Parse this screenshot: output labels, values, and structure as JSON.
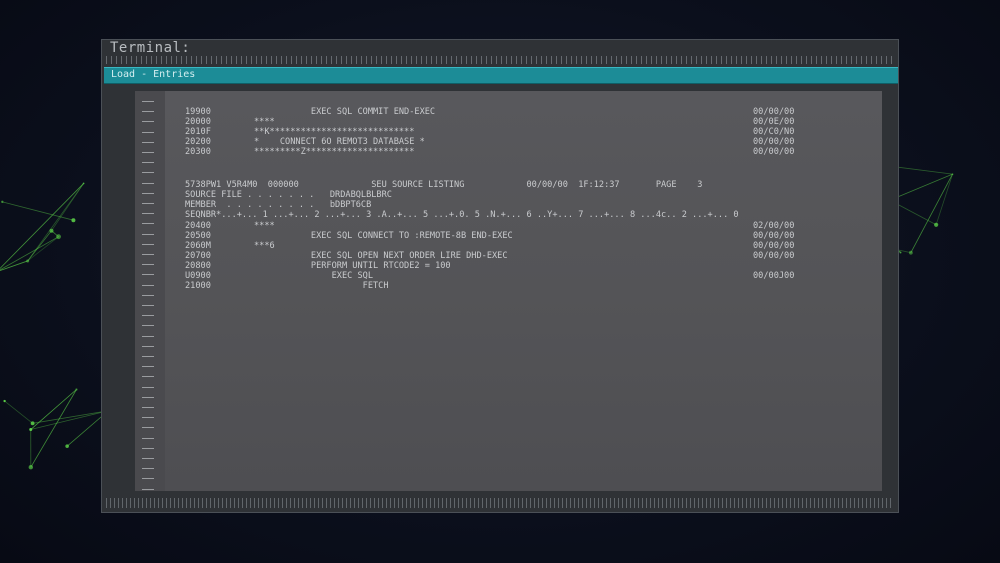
{
  "window": {
    "title": "Terminal:",
    "menu": "Load - Entries"
  },
  "listing": {
    "header_line": "5738PW1 V5R4M0  000000              SEU SOURCE LISTING            00/00/00  1F:12:37       PAGE    3",
    "source_file_line": "SOURCE FILE . . . . . . .   DRDABQLBLBRC",
    "member_line": "MEMBER  . . . . . . . . .   bDBPT6CB",
    "seq_ruler_line": "SEQNBR*...+... 1 ...+... 2 ...+... 3 .A..+... 5 ...+.0. 5 .N.+... 6 ..Y+... 7 ...+... 8 ...4c.. 2 ...+... 0",
    "block1": [
      {
        "seq": "19900",
        "code": "           EXEC SQL COMMIT END-EXEC",
        "stat": "00/00/00"
      },
      {
        "seq": "20000",
        "code": "****",
        "stat": "00/0E/00"
      },
      {
        "seq": "2010F",
        "code": "**K****************************",
        "stat": "00/C0/N0"
      },
      {
        "seq": "20200",
        "code": "*    CONNECT 6O REMOT3 DATABASE *",
        "stat": "00/00/00"
      },
      {
        "seq": "20300",
        "code": "*********Z*********************",
        "stat": "00/00/00"
      }
    ],
    "block2": [
      {
        "seq": "20400",
        "code": "****",
        "stat": "02/00/00"
      },
      {
        "seq": "20500",
        "code": "           EXEC SQL CONNECT TO :REMOTE-8B END-EXEC",
        "stat": "00/00/00"
      },
      {
        "seq": "2060M",
        "code": "***6",
        "stat": "00/00/00"
      },
      {
        "seq": "20700",
        "code": "           EXEC SQL OPEN NEXT ORDER LIRE DHD-EXEC",
        "stat": "00/00/00"
      },
      {
        "seq": "20800",
        "code": "           PERFORM UNTIL RTCODE2 = 100",
        "stat": ""
      },
      {
        "seq": "U0900",
        "code": "               EXEC SQL",
        "stat": "00/00J00"
      },
      {
        "seq": "21000",
        "code": "                     FETCH",
        "stat": ""
      }
    ]
  },
  "colors": {
    "accent": "#1c8c97",
    "screen": "#555558",
    "text": "#c9cbce",
    "network": "#5fd94a"
  }
}
